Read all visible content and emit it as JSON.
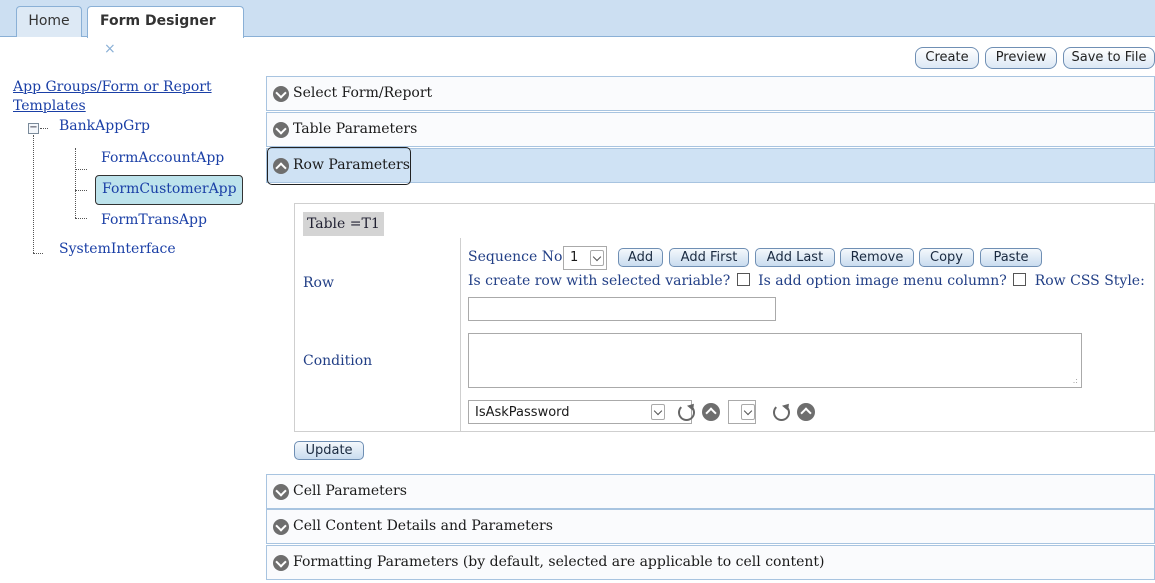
{
  "tabs": {
    "home": "Home",
    "form_designer": "Form Designer",
    "close_glyph": "×"
  },
  "toolbar": {
    "create": "Create",
    "preview": "Preview",
    "save_to_file": "Save to File"
  },
  "tree": {
    "root_line1": "App Groups/Form or Report",
    "root_line2": "Templates",
    "expander": "−",
    "group": "BankAppGrp",
    "children": [
      "FormAccountApp",
      "FormCustomerApp",
      "FormTransApp"
    ],
    "selected": "FormCustomerApp",
    "system": "SystemInterface"
  },
  "sections": {
    "select_form": "Select Form/Report",
    "table_params": "Table Parameters",
    "row_params": "Row Parameters",
    "cell_params": "Cell Parameters",
    "cell_content": "Cell Content Details and Parameters",
    "formatting": "Formatting Parameters (by default, selected are applicable to cell content)"
  },
  "row_panel": {
    "table_label": "Table =T1",
    "row_label": "Row",
    "condition_label": "Condition",
    "sequence_label": "Sequence No.",
    "sequence_value": "1",
    "buttons": [
      "Add",
      "Add First",
      "Add Last",
      "Remove",
      "Copy",
      "Paste"
    ],
    "create_row_question": "Is create row with selected variable?",
    "option_menu_question": "Is add option image menu column?",
    "row_css_label": "Row CSS Style:",
    "css_value": "",
    "condition_value": "",
    "variable_select": "IsAskPassword",
    "secondary_select": "",
    "update": "Update"
  }
}
